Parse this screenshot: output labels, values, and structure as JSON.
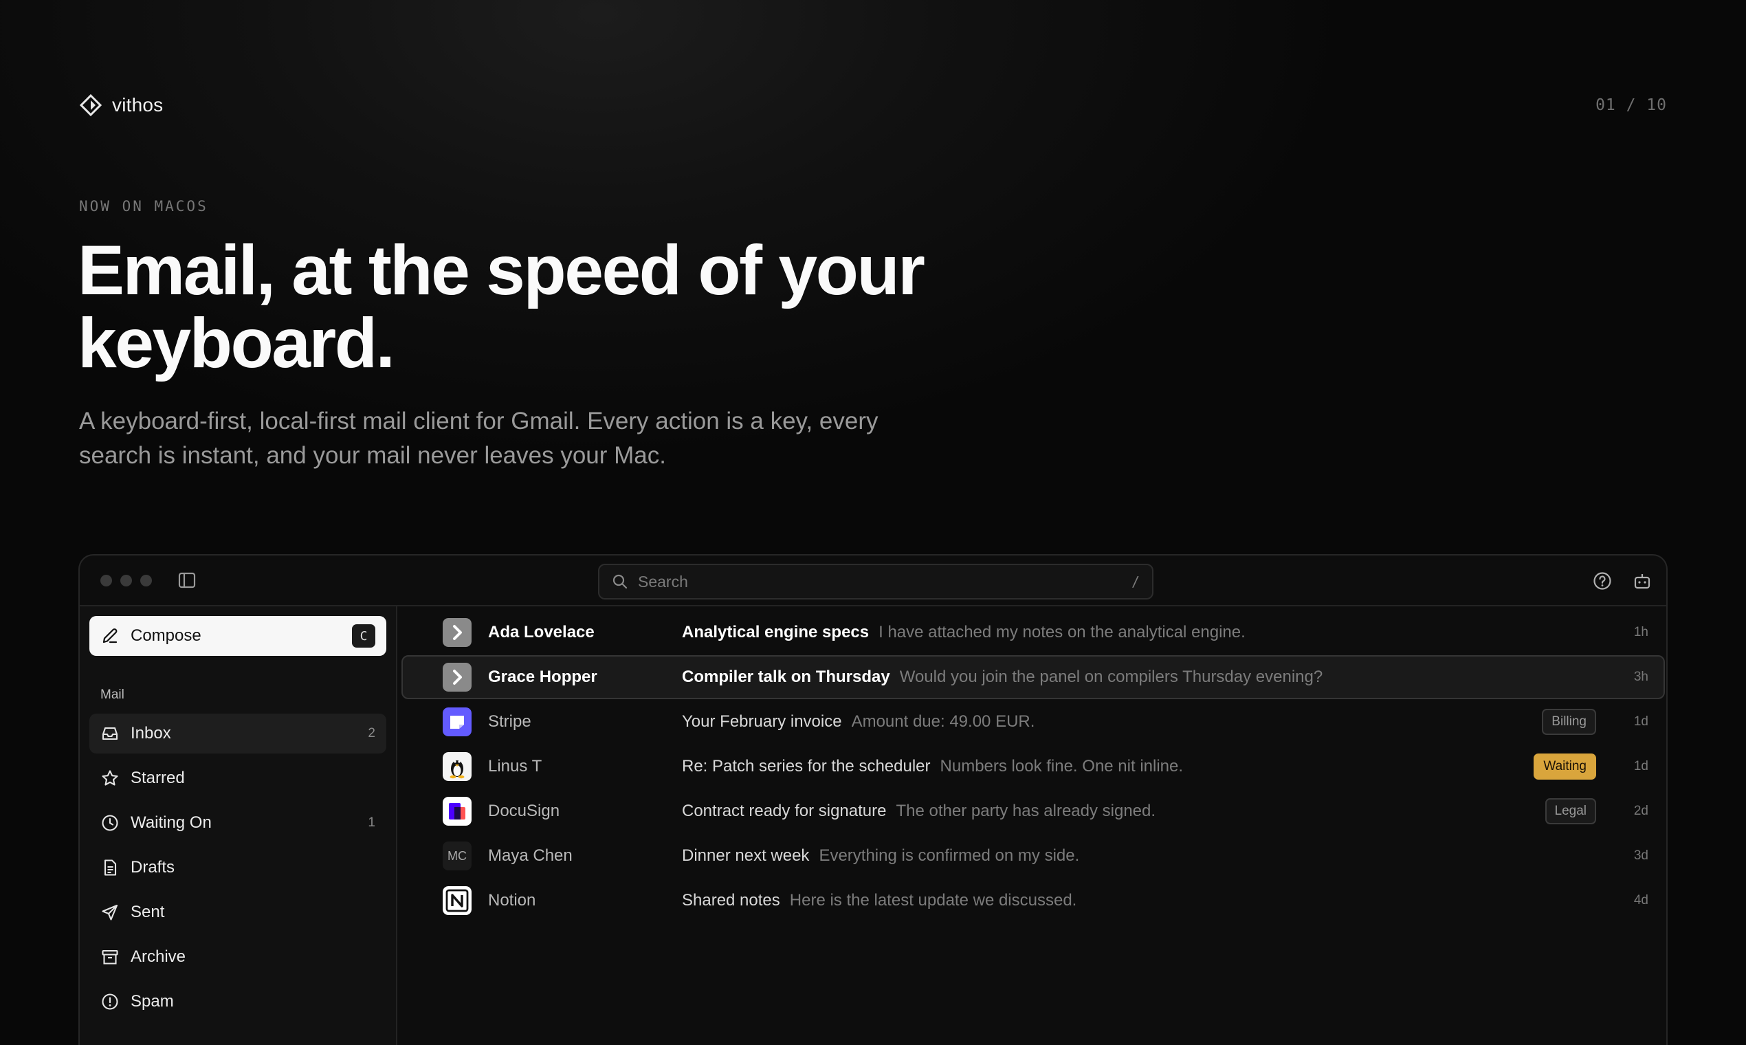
{
  "brand": {
    "name": "vithos",
    "pager": "01 / 10"
  },
  "hero": {
    "eyebrow": "NOW ON MACOS",
    "headline_line1": "Email, at the speed of your",
    "headline_line2": "keyboard.",
    "subhead_line1": "A keyboard-first, local-first mail client for Gmail. Every action is a key, every",
    "subhead_line2": "search is instant, and your mail never leaves your Mac."
  },
  "app": {
    "search": {
      "placeholder": "Search",
      "shortcut": "/"
    },
    "compose": {
      "label": "Compose",
      "shortcut": "C"
    },
    "sidebar": {
      "section": "Mail",
      "items": [
        {
          "label": "Inbox",
          "count": "2",
          "icon": "inbox-icon",
          "active": true
        },
        {
          "label": "Starred",
          "count": "",
          "icon": "star-icon"
        },
        {
          "label": "Waiting On",
          "count": "1",
          "icon": "clock-icon"
        },
        {
          "label": "Drafts",
          "count": "",
          "icon": "document-icon"
        },
        {
          "label": "Sent",
          "count": "",
          "icon": "send-icon"
        },
        {
          "label": "Archive",
          "count": "",
          "icon": "archive-icon"
        },
        {
          "label": "Spam",
          "count": "",
          "icon": "alert-icon"
        }
      ]
    },
    "emails": [
      {
        "sender": "Ada Lovelace",
        "subject": "Analytical engine specs",
        "preview": "I have attached my notes on the analytical engine.",
        "tag": "",
        "time": "1h",
        "unread": true,
        "avatar": "vithos-avatar-icon"
      },
      {
        "sender": "Grace Hopper",
        "subject": "Compiler talk on Thursday",
        "preview": "Would you join the panel on compilers Thursday evening?",
        "tag": "",
        "time": "3h",
        "unread": true,
        "selected": true,
        "avatar": "vithos-avatar-icon"
      },
      {
        "sender": "Stripe",
        "subject": "Your February invoice",
        "preview": "Amount due: 49.00 EUR.",
        "tag": "Billing",
        "time": "1d",
        "avatar": "stripe-logo-icon"
      },
      {
        "sender": "Linus T",
        "subject": "Re: Patch series for the scheduler",
        "preview": "Numbers look fine. One nit inline.",
        "tag": "Waiting",
        "time": "1d",
        "avatar": "penguin-icon"
      },
      {
        "sender": "DocuSign",
        "subject": "Contract ready for signature",
        "preview": "The other party has already signed.",
        "tag": "Legal",
        "time": "2d",
        "avatar": "docusign-logo-icon"
      },
      {
        "sender": "Maya Chen",
        "subject": "Dinner next week",
        "preview": "Everything is confirmed on my side.",
        "tag": "",
        "time": "3d",
        "avatar_text": "MC"
      },
      {
        "sender": "Notion",
        "subject": "Shared notes",
        "preview": "Here is the latest update we discussed.",
        "tag": "",
        "time": "4d",
        "avatar": "notion-logo-icon"
      }
    ]
  },
  "colors": {
    "accent_waiting": "#d9a53c",
    "stripe": "#635bff",
    "background": "#080808"
  }
}
